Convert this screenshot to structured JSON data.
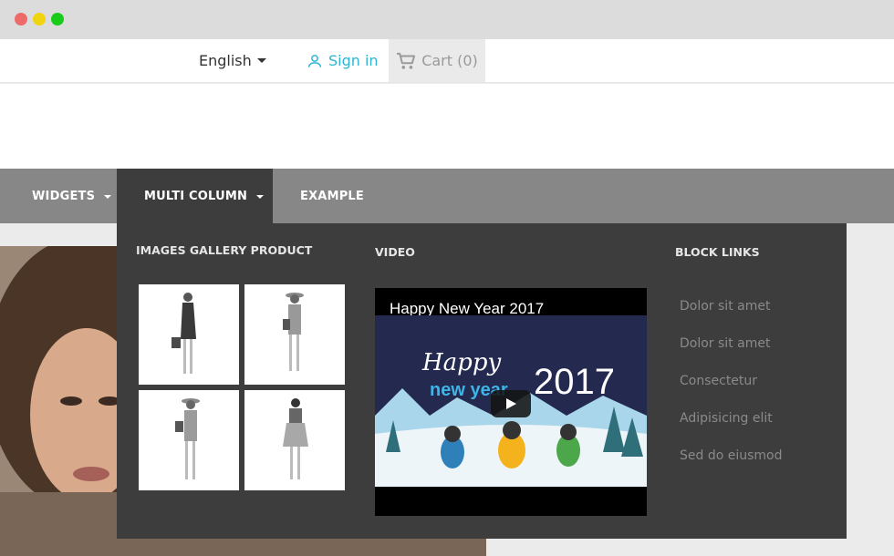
{
  "window": {
    "controls": [
      "close",
      "minimize",
      "maximize"
    ]
  },
  "topnav": {
    "language": "English",
    "sign_in": "Sign in",
    "cart": "Cart (0)",
    "colors": {
      "accent": "#2fb5d2",
      "cart_text": "#9a9a9a"
    }
  },
  "menu": {
    "items": [
      {
        "label": "WIDGETS",
        "has_dropdown": true
      },
      {
        "label": "MULTI COLUMN",
        "has_dropdown": true,
        "active": true
      },
      {
        "label": "EXAMPLE",
        "has_dropdown": false
      }
    ]
  },
  "dropdown": {
    "gallery_title": "IMAGES GALLERY PRODUCT",
    "video_title": "VIDEO",
    "links_title": "BLOCK LINKS",
    "video": {
      "caption": "Happy New Year 2017",
      "scene_text_top": "Happy",
      "scene_text_bottom": "new year",
      "scene_year": "2017"
    },
    "links": [
      "Dolor sit amet",
      "Dolor sit amet",
      "Consectetur",
      "Adipisicing elit",
      "Sed do eiusmod"
    ]
  },
  "icons": [
    "caret-down-icon",
    "user-icon",
    "cart-icon",
    "play-icon"
  ]
}
